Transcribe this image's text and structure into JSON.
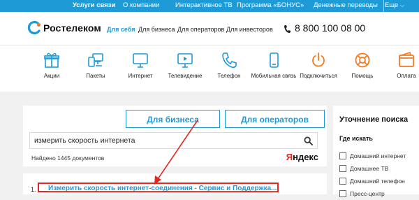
{
  "topnav": {
    "items": [
      "Услуги связи",
      "О компании",
      "Интерактивное ТВ",
      "Программа «БОНУС»",
      "Денежные переводы",
      "Еще"
    ]
  },
  "header": {
    "logo_text": "Ростелеком",
    "segments": [
      "Для себя",
      "Для бизнеса",
      "Для операторов",
      "Для инвесторов"
    ],
    "phone": "8 800 100 08 00"
  },
  "icons": [
    {
      "label": "Акции",
      "icon": "gift-icon"
    },
    {
      "label": "Пакеты",
      "icon": "packages-icon"
    },
    {
      "label": "Интернет",
      "icon": "monitor-icon"
    },
    {
      "label": "Телевидение",
      "icon": "tv-play-icon"
    },
    {
      "label": "Телефон",
      "icon": "phone-icon"
    },
    {
      "label": "Мобильная связь",
      "icon": "mobile-icon"
    },
    {
      "label": "Подключиться",
      "icon": "power-icon"
    },
    {
      "label": "Помощь",
      "icon": "lifebuoy-icon"
    },
    {
      "label": "Оплата",
      "icon": "wallet-icon"
    }
  ],
  "search": {
    "tabs": [
      "Для бизнеса",
      "Для операторов"
    ],
    "query": "измерить скорость интернета",
    "found": "Найдено 1445 документов",
    "provider": "Яндекс"
  },
  "result": {
    "number": "1.",
    "title": "Измерить скорость интернет-соединения - Сервис и Поддержка..."
  },
  "sidebar": {
    "title": "Уточнение поиска",
    "subtitle": "Где искать",
    "options": [
      "Домашний интернет",
      "Домашнее ТВ",
      "Домашний телефон",
      "Пресс-центр"
    ]
  },
  "colors": {
    "brand_blue": "#1e9ad6",
    "accent_orange": "#f47a20",
    "highlight_red": "#e52620"
  }
}
